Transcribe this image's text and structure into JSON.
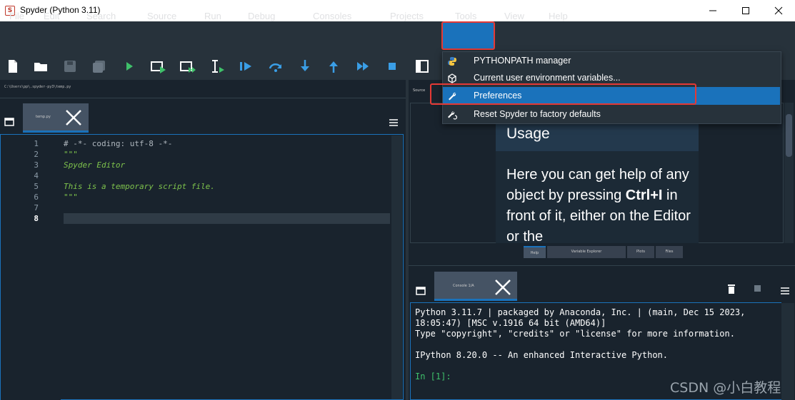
{
  "window": {
    "title": "Spyder (Python 3.11)",
    "icon_letter": "S"
  },
  "menubar": {
    "items": [
      "File",
      "Edit",
      "Search",
      "Source",
      "Run",
      "Debug",
      "Consoles",
      "Projects",
      "Tools",
      "View",
      "Help"
    ],
    "active": "Tools"
  },
  "toolbar": {
    "icons": [
      "new-file-icon",
      "open-folder-icon",
      "save-icon",
      "save-all-icon",
      "run-icon",
      "run-cell-icon",
      "run-cell-advance-icon",
      "run-selection-icon",
      "debug-run-icon",
      "step-over-icon",
      "step-into-icon",
      "step-return-icon",
      "continue-icon",
      "stop-icon",
      "maximize-pane-icon"
    ]
  },
  "editor": {
    "path": "C:\\Users\\pp\\.spyder-py3\\temp.py",
    "tab_label": "temp.py",
    "line_numbers": [
      "1",
      "2",
      "3",
      "4",
      "5",
      "6",
      "7",
      "8"
    ],
    "current_line": "8",
    "lines": [
      "# -*- coding: utf-8 -*-",
      "\"\"\"",
      "Spyder Editor",
      "",
      "This is a temporary script file.",
      "\"\"\"",
      "",
      ""
    ]
  },
  "help": {
    "source_label": "Source",
    "usage_title": "Usage",
    "usage_text_1": "Here you can get help of any object by pressing ",
    "usage_bold": "Ctrl+I",
    "usage_text_2": " in front of it, either on the Editor or the",
    "bottom_tabs": [
      "Help",
      "Variable Explorer",
      "Plots",
      "Files"
    ]
  },
  "console": {
    "tab_label": "Console 1/A",
    "lines": [
      "Python 3.11.7 | packaged by Anaconda, Inc. | (main, Dec 15 2023,",
      "18:05:47) [MSC v.1916 64 bit (AMD64)]",
      "Type \"copyright\", \"credits\" or \"license\" for more information.",
      "",
      "IPython 8.20.0 -- An enhanced Interactive Python.",
      "",
      "In [1]:"
    ]
  },
  "tools_menu": {
    "items": [
      {
        "label": "PYTHONPATH manager",
        "icon": "python-icon"
      },
      {
        "label": "Current user environment variables...",
        "icon": "cube-icon"
      },
      {
        "label": "Preferences",
        "icon": "wrench-icon",
        "highlighted": true
      },
      {
        "label": "Reset Spyder to factory defaults",
        "icon": "reset-wrench-icon"
      }
    ]
  },
  "watermark": "CSDN @小白教程",
  "colors": {
    "accent": "#1a72bb",
    "highlight_box": "#e53935",
    "background": "#19232d",
    "comment_green": "#7ec34c"
  }
}
